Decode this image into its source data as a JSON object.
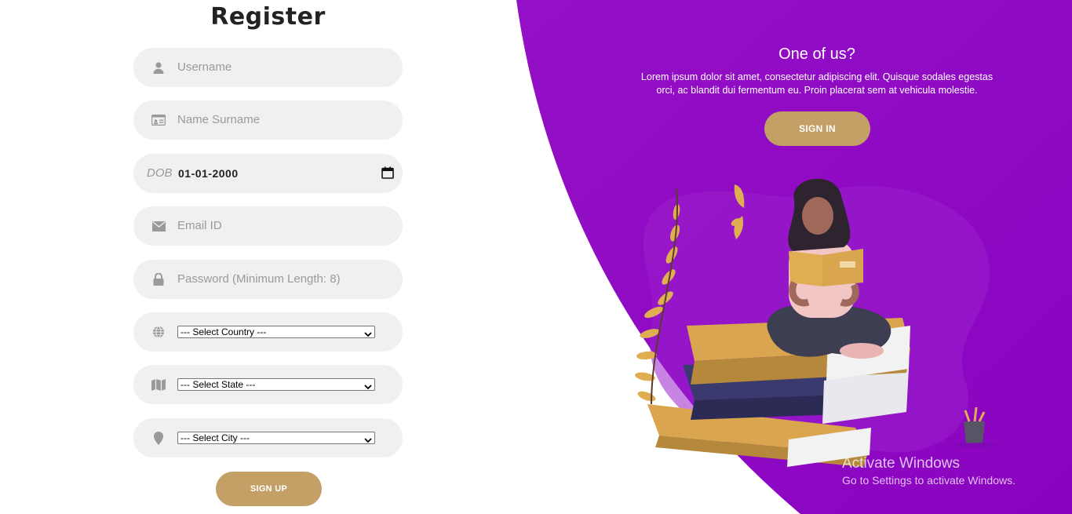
{
  "form": {
    "title": "Register",
    "username_placeholder": "Username",
    "name_placeholder": "Name Surname",
    "dob_label": "DOB",
    "dob_value": "01-01-2000",
    "email_placeholder": "Email ID",
    "password_placeholder": "Password (Minimum Length: 8)",
    "country_selected": "--- Select Country ---",
    "state_selected": "--- Select State ---",
    "city_selected": "--- Select City ---",
    "signup_label": "SIGN UP"
  },
  "hero": {
    "title": "One of us?",
    "text": "Lorem ipsum dolor sit amet, consectetur adipiscing elit. Quisque sodales egestas orci, ac blandit dui fermentum eu. Proin placerat sem at vehicula molestie.",
    "signin_label": "SIGN IN"
  },
  "watermark": {
    "title": "Activate Windows",
    "subtitle": "Go to Settings to activate Windows."
  },
  "colors": {
    "purple": "#8e08c4",
    "gold": "#c4a066",
    "field_bg": "#f0f0f0"
  },
  "icons": [
    "user-icon",
    "id-card-icon",
    "calendar-icon",
    "envelope-icon",
    "lock-icon",
    "globe-icon",
    "map-icon",
    "map-marker-icon"
  ]
}
